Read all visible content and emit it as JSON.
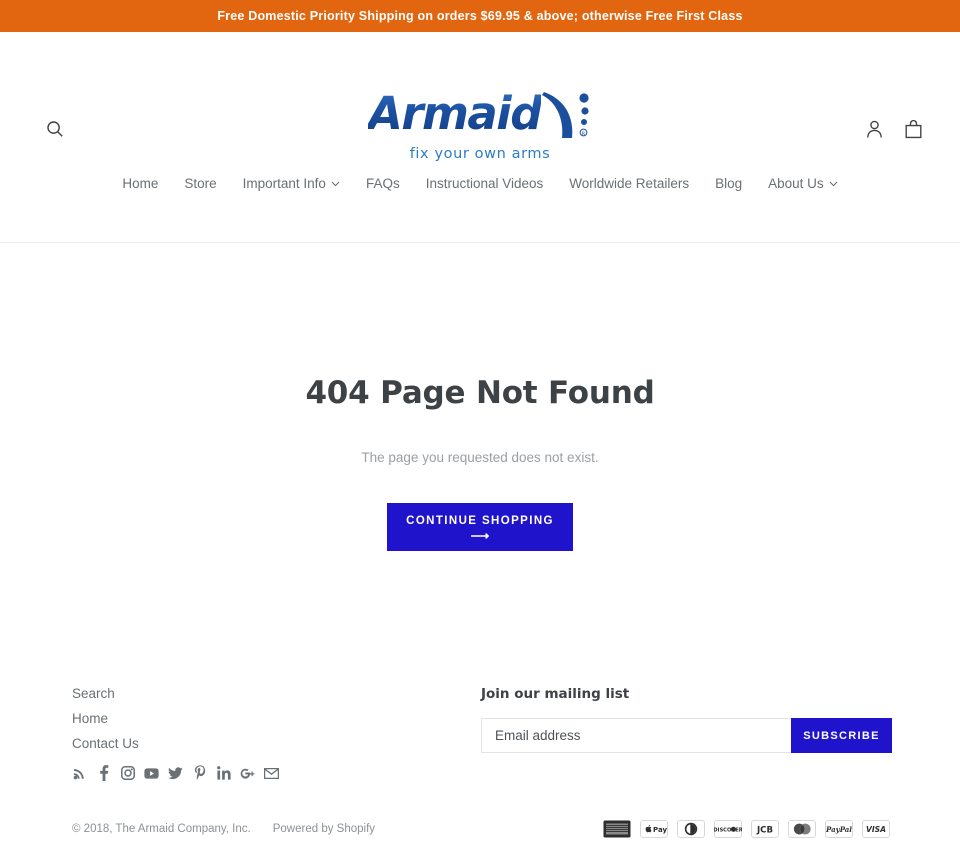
{
  "announcement": {
    "text": "Free Domestic Priority Shipping on orders $69.95 & above; otherwise Free First Class",
    "background": "#e2650f",
    "color": "#ffffff"
  },
  "header": {
    "search_icon": "search-icon",
    "account_icon": "account-person-icon",
    "cart_icon": "shopping-bag-icon",
    "logo": {
      "wordmark": "Armaid",
      "tagline": "fix your own arms",
      "registered_mark": "®",
      "wordmark_color": "#1b4f9e",
      "tagline_color": "#2e7cc0"
    }
  },
  "nav": {
    "items": [
      {
        "label": "Home",
        "has_dropdown": false
      },
      {
        "label": "Store",
        "has_dropdown": false
      },
      {
        "label": "Important Info",
        "has_dropdown": true,
        "caret": "⌄"
      },
      {
        "label": "FAQs",
        "has_dropdown": false
      },
      {
        "label": "Instructional Videos",
        "has_dropdown": false
      },
      {
        "label": "Worldwide Retailers",
        "has_dropdown": false
      },
      {
        "label": "Blog",
        "has_dropdown": false
      },
      {
        "label": "About Us",
        "has_dropdown": true,
        "caret": "⌄"
      }
    ]
  },
  "main": {
    "title": "404 Page Not Found",
    "subtitle": "The page you requested does not exist.",
    "cta_label": "CONTINUE SHOPPING",
    "cta_arrow": "⟶",
    "cta_color": "#1f13cc"
  },
  "footer": {
    "links": [
      {
        "label": "Search"
      },
      {
        "label": "Home"
      },
      {
        "label": "Contact Us"
      }
    ],
    "social": [
      {
        "name": "rss-icon",
        "label": "RSS"
      },
      {
        "name": "facebook-icon",
        "label": "Facebook"
      },
      {
        "name": "instagram-icon",
        "label": "Instagram"
      },
      {
        "name": "youtube-icon",
        "label": "YouTube"
      },
      {
        "name": "twitter-icon",
        "label": "Twitter"
      },
      {
        "name": "pinterest-icon",
        "label": "Pinterest"
      },
      {
        "name": "linkedin-icon",
        "label": "LinkedIn"
      },
      {
        "name": "googleplus-icon",
        "label": "Google Plus"
      },
      {
        "name": "email-icon",
        "label": "Email"
      }
    ],
    "newsletter": {
      "title": "Join our mailing list",
      "placeholder": "Email address",
      "value": "",
      "button_label": "SUBSCRIBE",
      "button_color": "#1f13cc"
    },
    "copyright": "© 2018, The Armaid Company, Inc.",
    "powered_by": "Powered by Shopify",
    "payments": [
      {
        "name": "american-express-icon",
        "label": "AMERICAN EXPRESS"
      },
      {
        "name": "apple-pay-icon",
        "label": "Pay"
      },
      {
        "name": "diners-club-icon",
        "label": "Diners Club"
      },
      {
        "name": "discover-icon",
        "label": "DISCOVER"
      },
      {
        "name": "jcb-icon",
        "label": "JCB"
      },
      {
        "name": "mastercard-icon",
        "label": "MasterCard"
      },
      {
        "name": "paypal-icon",
        "label": "PayPal"
      },
      {
        "name": "visa-icon",
        "label": "VISA"
      }
    ]
  }
}
